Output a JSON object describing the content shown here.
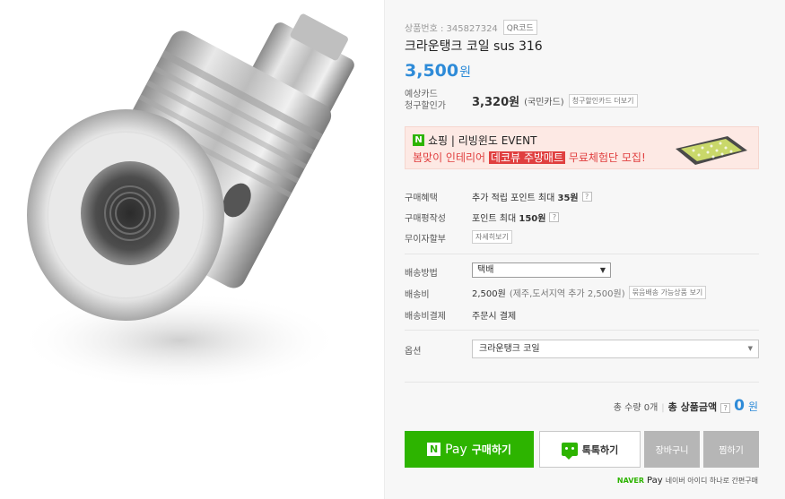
{
  "product": {
    "number_text": "상품번호 : 345827324",
    "qr_label": "QR코드",
    "title": "크라운탱크 코일 sus 316",
    "price": "3,500",
    "price_unit": "원",
    "image_alt": "크라운탱크 코일"
  },
  "card": {
    "label_line1": "예상카드",
    "label_line2": "청구할인가",
    "price": "3,320원",
    "card_name": "(국민카드)",
    "more_label": "청구할인카드 더보기"
  },
  "banner": {
    "badge": "N",
    "line1": "쇼핑 | 리빙윈도 EVENT",
    "line2_prefix": "봄맞이 인테리어 ",
    "line2_highlight": "데코뷰 주방매트",
    "line2_suffix": " 무료체험단 모집!"
  },
  "benefits": {
    "purchase_label": "구매혜택",
    "purchase_prefix": "추가 적립 포인트 최대 ",
    "purchase_amount": "35원",
    "review_label": "구매평작성",
    "review_prefix": "포인트 최대 ",
    "review_amount": "150원",
    "installment_label": "무이자할부",
    "installment_button": "자세히보기",
    "help_glyph": "?"
  },
  "shipping": {
    "method_label": "배송방법",
    "method_value": "택배",
    "fee_label": "배송비",
    "fee_value": "2,500원",
    "fee_note": "(제주,도서지역 추가 2,500원)",
    "bundle_button": "묶음배송 가능상품 보기",
    "payment_label": "배송비결제",
    "payment_value": "주문시 결제"
  },
  "option": {
    "label": "옵션",
    "selected": "크라운탱크 코일"
  },
  "total": {
    "qty_text": "총 수량 0개",
    "label": "총 상품금액",
    "help_glyph": "?",
    "value": "0",
    "unit": "원"
  },
  "actions": {
    "pay_word": "Pay",
    "pay_label": "구매하기",
    "talk_label": "톡톡하기",
    "cart_label": "장바구니",
    "wish_label": "찜하기"
  },
  "naverpay_note": {
    "naver": "NAVER",
    "pay": "Pay",
    "text": "네이버 아이디 하나로 간편구매"
  },
  "colors": {
    "naver_green": "#2db400",
    "price_blue": "#2e8bd8",
    "banner_red": "#e03f3f",
    "button_gray": "#b6b6b6"
  }
}
